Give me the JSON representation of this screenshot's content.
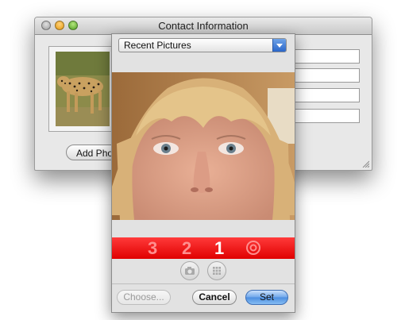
{
  "window": {
    "title": "Contact Information",
    "add_photo_label": "Add Photo"
  },
  "popover": {
    "source_select": "Recent Pictures",
    "countdown": [
      "3",
      "2",
      "1"
    ],
    "buttons": {
      "choose": "Choose...",
      "cancel": "Cancel",
      "set": "Set"
    }
  },
  "icons": {
    "flash": "flash-icon",
    "camera": "camera-icon",
    "effects": "grid-effects-icon",
    "popup_arrow": "chevron-down-icon"
  },
  "colors": {
    "countdown_bar": "#ff1a1a",
    "default_button": "#6ea6ea"
  }
}
